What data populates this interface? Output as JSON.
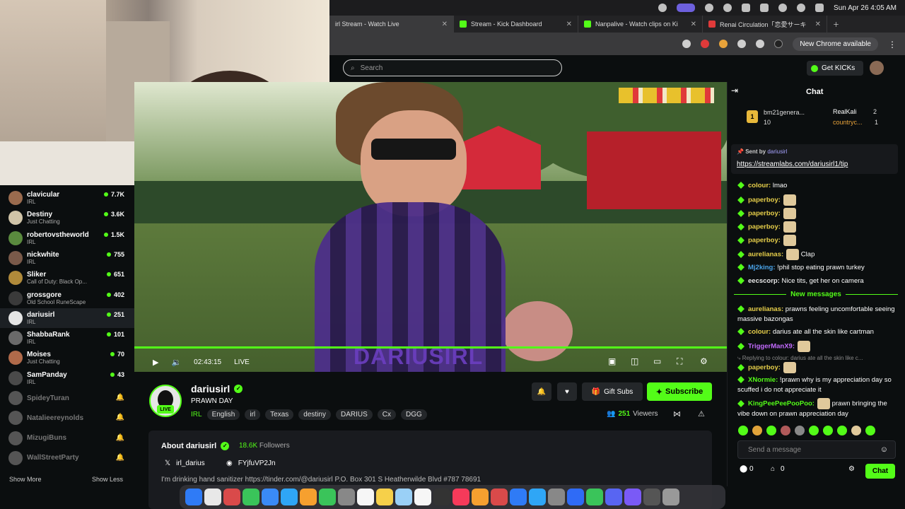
{
  "menubar": {
    "datetime": "Sun Apr 26  4:05 AM"
  },
  "browser": {
    "tabs": [
      {
        "title": "irl Stream - Watch Live",
        "color": "#53fc18"
      },
      {
        "title": "Stream - Kick Dashboard",
        "color": "#53fc18"
      },
      {
        "title": "Nanpalive - Watch clips on Ki",
        "color": "#53fc18"
      },
      {
        "title": "Renai Circulation「恋愛サーキ",
        "color": "#e03a3a"
      }
    ],
    "new_chrome_label": "New Chrome available"
  },
  "header": {
    "search_placeholder": "Search",
    "get_kicks_label": "Get KICKs"
  },
  "sidebar": {
    "channels": [
      {
        "name": "clavicular",
        "category": "IRL",
        "viewers": "7.7K",
        "color": "#9a6b4e"
      },
      {
        "name": "Destiny",
        "category": "Just Chatting",
        "viewers": "3.6K",
        "color": "#d0c4a8"
      },
      {
        "name": "robertovstheworld",
        "category": "IRL",
        "viewers": "1.5K",
        "color": "#5a8a3e"
      },
      {
        "name": "nickwhite",
        "category": "IRL",
        "viewers": "755",
        "color": "#7a5a4a"
      },
      {
        "name": "Sliker",
        "category": "Call of Duty: Black Op...",
        "viewers": "651",
        "color": "#b08a3a"
      },
      {
        "name": "grossgore",
        "category": "Old School RuneScape",
        "viewers": "402",
        "color": "#3a3a3a"
      },
      {
        "name": "dariusirl",
        "category": "IRL",
        "viewers": "251",
        "color": "#e5e5e5"
      },
      {
        "name": "ShabbaRank",
        "category": "IRL",
        "viewers": "101",
        "color": "#6a6a6a"
      },
      {
        "name": "Moises",
        "category": "Just Chatting",
        "viewers": "70",
        "color": "#b06a4a"
      },
      {
        "name": "SamPanday",
        "category": "IRL",
        "viewers": "43",
        "color": "#4a4a4a"
      }
    ],
    "offline_channels": [
      "SpideyTuran",
      "Natalieereynolds",
      "MizugiBuns",
      "WallStreetParty"
    ],
    "show_more": "Show More",
    "show_less": "Show Less"
  },
  "player": {
    "time": "02:43:15",
    "live_label": "LIVE",
    "watermark": "DARIUSIRL"
  },
  "channel": {
    "name": "dariusirl",
    "stream_title": "PRAWN DAY",
    "live_badge": "LIVE",
    "category": "IRL",
    "tags": [
      "English",
      "irl",
      "Texas",
      "destiny",
      "DARIUS",
      "Cx",
      "DGG"
    ],
    "gift_subs_label": "Gift Subs",
    "subscribe_label": "Subscribe",
    "viewers_count": "251",
    "viewers_label": "Viewers",
    "about_title": "About dariusirl",
    "followers_count": "18.6K",
    "followers_label": "Followers",
    "twitter": "irl_darius",
    "discord": "FYjfuVP2Jn",
    "bio": "I'm drinking hand sanitizer https://tinder.com/@dariusirl P.O. Box 301 S Heatherwilde Blvd #787 78691"
  },
  "chat": {
    "title": "Chat",
    "leaderboard": [
      {
        "rank": "1",
        "name": "bm21genera...",
        "count": "10"
      },
      {
        "name": "RealKali",
        "count": "2"
      },
      {
        "name": "countryc...",
        "count": "1"
      }
    ],
    "pinned": {
      "sent_by_label": "Sent by",
      "sender": "dariusirl",
      "link": "https://streamlabs.com/dariusirl1/tip"
    },
    "messages": [
      {
        "user": "colour",
        "text": "lmao",
        "color": "#e8d04a"
      },
      {
        "user": "paperboy",
        "text": "",
        "color": "#e8d04a",
        "emote": true
      },
      {
        "user": "paperboy",
        "text": "",
        "color": "#e8d04a",
        "emote": true
      },
      {
        "user": "paperboy",
        "text": "",
        "color": "#e8d04a",
        "emote": true
      },
      {
        "user": "paperboy",
        "text": "",
        "color": "#e8d04a",
        "emote": true
      },
      {
        "user": "aurelianas",
        "text": "Clap",
        "color": "#e8d04a",
        "emote": true
      },
      {
        "user": "Mj2king",
        "text": "!phil stop eating prawn turkey",
        "color": "#4aa3e8"
      },
      {
        "user": "eecscorp",
        "text": "Nice tits, get her on camera",
        "color": "#e8e8e8"
      }
    ],
    "new_messages_label": "New messages",
    "new_messages": [
      {
        "user": "aurelianas",
        "text": "prawns feeling uncomfortable seeing massive bazongas",
        "color": "#e8d04a"
      },
      {
        "user": "colour",
        "text": "darius ate all the skin like cartman",
        "color": "#e8d04a"
      },
      {
        "user": "TriggerManX9",
        "text": "",
        "color": "#c46bff",
        "emote": true
      },
      {
        "user": "paperboy",
        "text": "",
        "color": "#e8d04a",
        "emote": true,
        "reply": "Replying to colour: darius ate all the skin like c..."
      },
      {
        "user": "XNormie",
        "text": "!prawn why is my appreciation day so scuffed i do not appreciate it",
        "color": "#53fc18"
      },
      {
        "user": "KingPeePeePooPoo",
        "text": "prawn bringing the vibe down on prawn appreciation day",
        "color": "#53fc18",
        "emote": true
      }
    ],
    "input_placeholder": "Send a message",
    "kicks_count": "0",
    "gifts_count": "0",
    "send_label": "Chat"
  }
}
